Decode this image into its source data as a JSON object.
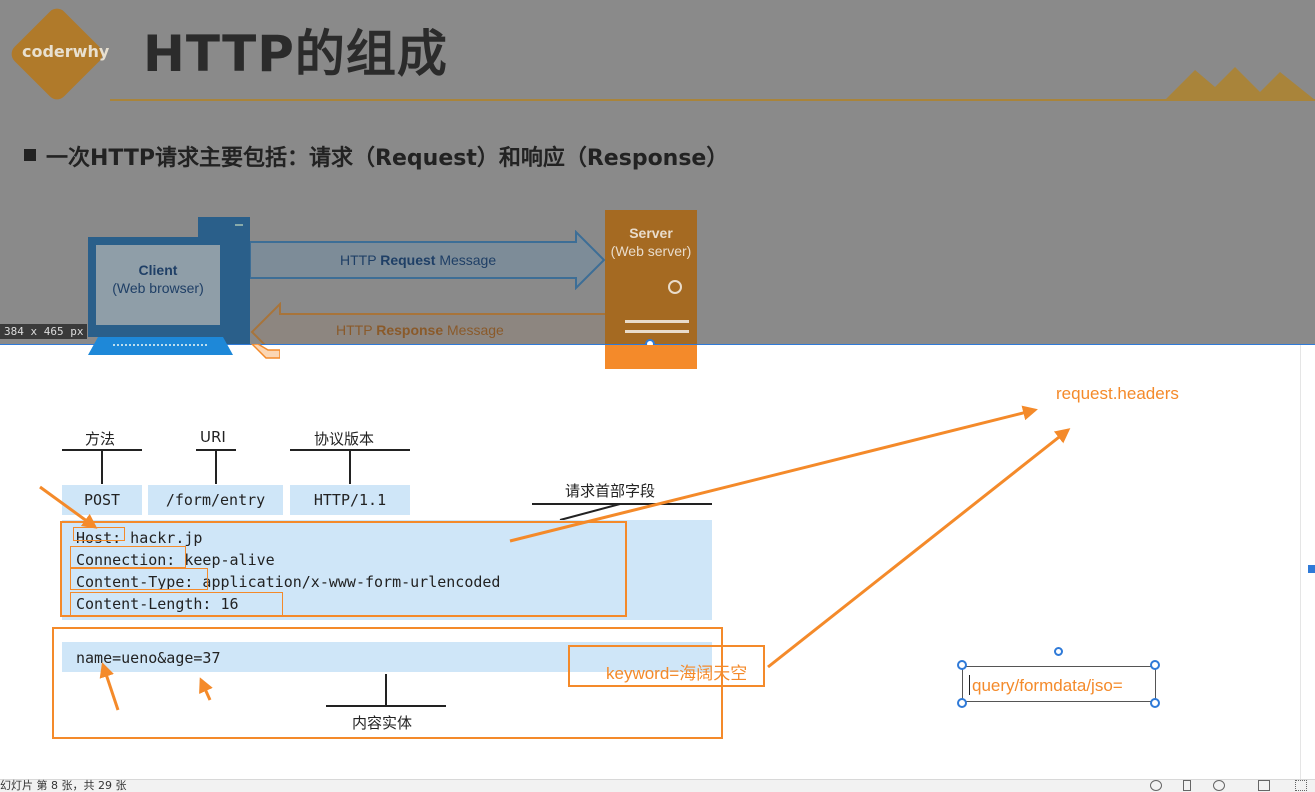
{
  "slide": {
    "logo_text": "coderwhy",
    "title": "HTTP的组成",
    "bullet": "一次HTTP请求主要包括：请求（Request）和响应（Response）",
    "dimension_label": "384 x 465  px"
  },
  "diagram": {
    "client_title": "Client",
    "client_sub": "(Web browser)",
    "server_title": "Server",
    "server_sub": "(Web server)",
    "request_prefix": "HTTP ",
    "request_bold": "Request",
    "request_suffix": " Message",
    "response_prefix": "HTTP ",
    "response_bold": "Response",
    "response_suffix": " Message"
  },
  "request": {
    "method_label": "方法",
    "uri_label": "URI",
    "version_label": "协议版本",
    "header_fields_label": "请求首部字段",
    "body_label": "内容实体",
    "method": "POST",
    "uri": "/form/entry",
    "version": "HTTP/1.1",
    "headers": [
      "Host: hackr.jp",
      "Connection: keep-alive",
      "Content-Type: application/x-www-form-urlencoded",
      "Content-Length: 16"
    ],
    "body": "name=ueno&age=37"
  },
  "annotations": {
    "request_headers": "request.headers",
    "keyword": "keyword=海阔天空",
    "textbox_value": "query/formdata/jso="
  },
  "status": {
    "text": "幻灯片 第 8 张，共 29 张"
  },
  "colors": {
    "accent_orange": "#f48a2a",
    "cell_blue": "#cfe6f8",
    "selection_blue": "#2f7ad8"
  }
}
